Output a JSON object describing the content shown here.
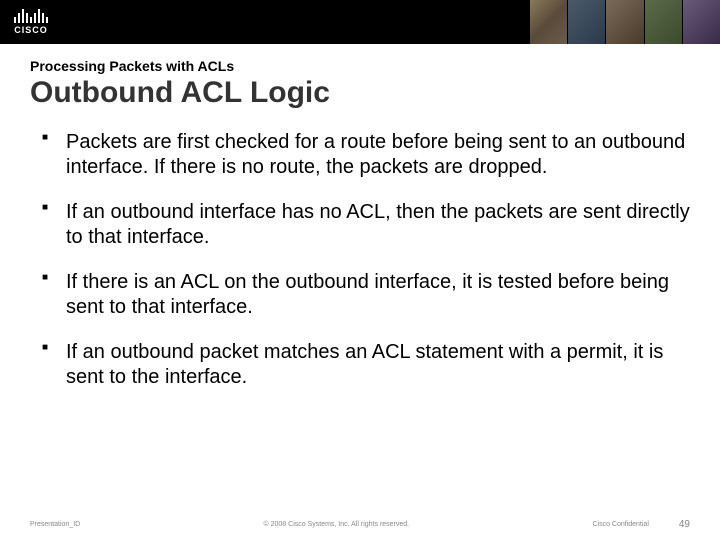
{
  "header": {
    "logo_text": "CISCO"
  },
  "slide": {
    "section_label": "Processing Packets with ACLs",
    "title": "Outbound ACL Logic",
    "bullets": [
      "Packets are first checked for a route before being sent to an outbound interface. If there is no route, the packets are dropped.",
      "If an outbound interface has no ACL, then the packets are sent directly to that interface.",
      "If there is an ACL on the outbound interface, it is tested before being sent to that interface.",
      "If an outbound packet matches an ACL statement with a permit, it is sent to the interface."
    ]
  },
  "footer": {
    "presentation_id": "Presentation_ID",
    "copyright": "© 2008 Cisco Systems, Inc. All rights reserved.",
    "confidential": "Cisco Confidential",
    "page_number": "49"
  }
}
